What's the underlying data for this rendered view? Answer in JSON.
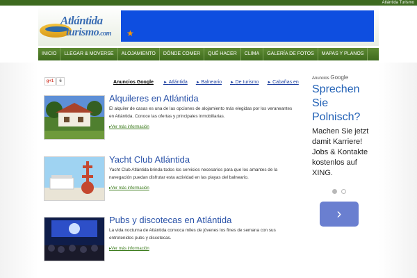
{
  "site_name": "Atlántida Turismo",
  "logo": {
    "line1": "Atlántida",
    "line2": "turismo",
    "suffix": ".com"
  },
  "nav": {
    "items": [
      "INICIO",
      "LLEGAR & MOVERSE",
      "ALOJAMIENTO",
      "DÓNDE COMER",
      "QUÉ HACER",
      "CLIMA",
      "GALERÍA DE FOTOS",
      "MAPAS Y PLANOS"
    ]
  },
  "social": {
    "gplus_label": "g+1",
    "gplus_count": "6"
  },
  "ad_links": {
    "label": "Anuncios Google",
    "links": [
      "Atlántida",
      "Balneario",
      "De turismo",
      "Cabañas en"
    ]
  },
  "articles": [
    {
      "title": "Alquileres en Atlántida",
      "text": "El alquiler de casas es una de las opciones de alojamiento más elegidas por los veraneantes en Atlántida. Conoce las ofertas y principales inmobiliarias.",
      "more": "Ver más información"
    },
    {
      "title": "Yacht Club Atlántida",
      "text": "Yacht Club Atlántida brinda todos los servicios necesarios para que los amantes de la navegación puedan disfrutar esta actividad en las playas del balneario.",
      "more": "Ver más información"
    },
    {
      "title": "Pubs y discotecas en Atlántida",
      "text": "La vida nocturna de Atlántida convoca miles de jóvenes los fines de semana con sus entretenidos pubs y discotecas.",
      "more": "Ver más información"
    }
  ],
  "side_ad": {
    "label_prefix": "Anuncios",
    "label_brand": "Google",
    "title": "Sprechen Sie Polnisch?",
    "body": "Machen Sie jetzt damit Karriere! Jobs & Kontakte kostenlos auf XING.",
    "button_icon": "chevron-right-icon",
    "button_glyph": "›"
  },
  "colors": {
    "nav_green": "#4c7a26",
    "title_blue": "#2a52a8",
    "banner_blue": "#0e4ee0"
  }
}
